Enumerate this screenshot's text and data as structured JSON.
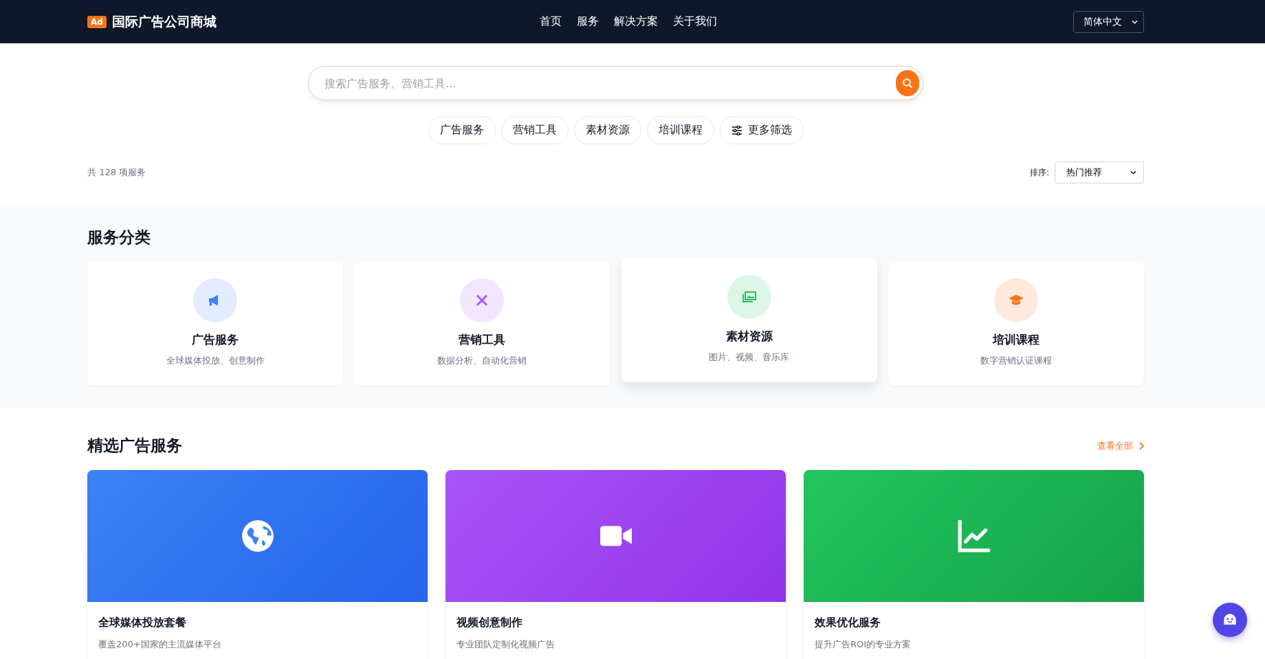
{
  "header": {
    "logo_badge": "Ad",
    "site_name": "国际广告公司商城",
    "nav": [
      {
        "label": "首页"
      },
      {
        "label": "服务"
      },
      {
        "label": "解决方案"
      },
      {
        "label": "关于我们"
      }
    ],
    "language": "简体中文"
  },
  "search": {
    "placeholder": "搜索广告服务、营销工具..."
  },
  "filters": [
    {
      "kind": "chip",
      "label": "广告服务"
    },
    {
      "kind": "chip",
      "label": "营销工具"
    },
    {
      "kind": "chip",
      "label": "素材资源"
    },
    {
      "kind": "chip",
      "label": "培训课程"
    },
    {
      "kind": "more",
      "label": "更多筛选"
    }
  ],
  "result_count": "共 128 项服务",
  "sort": {
    "label": "排序:",
    "value": "热门推荐"
  },
  "categories": {
    "title": "服务分类",
    "items": [
      {
        "color": "#3b82f6",
        "title": "广告服务",
        "subtitle": "全球媒体投放、创意制作",
        "raised": false
      },
      {
        "color": "#a855f7",
        "title": "营销工具",
        "subtitle": "数据分析、自动化营销",
        "raised": false
      },
      {
        "color": "#22c55e",
        "title": "素材资源",
        "subtitle": "图片、视频、音乐库",
        "raised": true
      },
      {
        "color": "#f97316",
        "title": "培训课程",
        "subtitle": "数字营销认证课程",
        "raised": false
      }
    ]
  },
  "featured": {
    "title": "精选广告服务",
    "view_all": "查看全部",
    "items": [
      {
        "color": "#3b82f6",
        "title": "全球媒体投放套餐",
        "description": "覆盖200+国家的主流媒体平台"
      },
      {
        "color": "#a855f7",
        "title": "视频创意制作",
        "description": "专业团队定制化视频广告"
      },
      {
        "color": "#22c55e",
        "title": "效果优化服务",
        "description": "提升广告ROI的专业方案"
      }
    ]
  }
}
